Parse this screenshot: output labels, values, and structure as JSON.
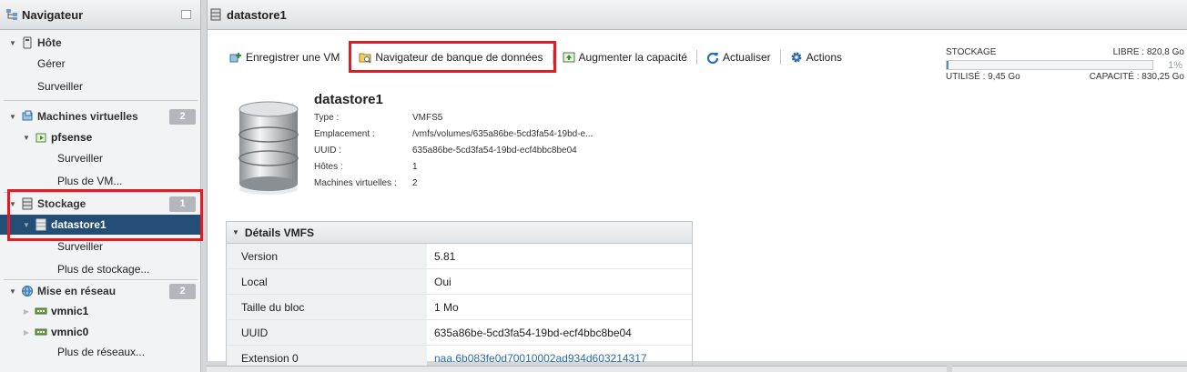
{
  "navigator": {
    "title": "Navigateur",
    "host": {
      "label": "Hôte",
      "children": [
        "Gérer",
        "Surveiller"
      ]
    },
    "vms": {
      "label": "Machines virtuelles",
      "count": "2",
      "vm_name": "pfsense",
      "vm_children": [
        "Surveiller"
      ],
      "more": "Plus de VM..."
    },
    "storage": {
      "label": "Stockage",
      "count": "1",
      "datastore": "datastore1",
      "children": [
        "Surveiller"
      ],
      "more": "Plus de stockage..."
    },
    "network": {
      "label": "Mise en réseau",
      "count": "2",
      "nics": [
        "vmnic1",
        "vmnic0"
      ],
      "more": "Plus de réseaux..."
    }
  },
  "main": {
    "title": "datastore1",
    "toolbar": {
      "register_vm": "Enregistrer une VM",
      "datastore_browser": "Navigateur de banque de données",
      "increase_capacity": "Augmenter la capacité",
      "refresh": "Actualiser",
      "actions": "Actions"
    },
    "storage_summary": {
      "label": "STOCKAGE",
      "free": "LIBRE : 820,8 Go",
      "percent": "1%",
      "percent_value": 0.01,
      "used": "UTILISÉ : 9,45 Go",
      "capacity": "CAPACITÉ : 830,25 Go"
    },
    "datastore": {
      "name": "datastore1",
      "properties": [
        {
          "key": "Type :",
          "value": "VMFS5"
        },
        {
          "key": "Emplacement :",
          "value": "/vmfs/volumes/635a86be-5cd3fa54-19bd-e..."
        },
        {
          "key": "UUID :",
          "value": "635a86be-5cd3fa54-19bd-ecf4bbc8be04"
        },
        {
          "key": "Hôtes :",
          "value": "1"
        },
        {
          "key": "Machines virtuelles :",
          "value": "2"
        }
      ]
    },
    "vmfs_details": {
      "title": "Détails VMFS",
      "rows": [
        {
          "key": "Version",
          "value": "5.81"
        },
        {
          "key": "Local",
          "value": "Oui"
        },
        {
          "key": "Taille du bloc",
          "value": "1 Mo"
        },
        {
          "key": "UUID",
          "value": "635a86be-5cd3fa54-19bd-ecf4bbc8be04"
        },
        {
          "key": "Extension 0",
          "value": "naa.6b083fe0d70010002ad934d603214317"
        }
      ]
    }
  },
  "colors": {
    "selection": "#244d75",
    "highlight_box": "#e31b23",
    "badge": "#b3b7bb"
  }
}
